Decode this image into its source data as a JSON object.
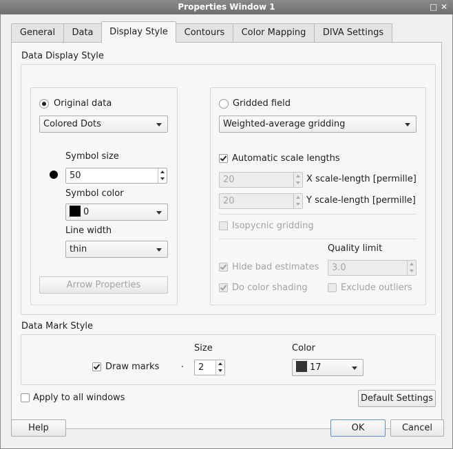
{
  "window": {
    "title": "Properties Window 1",
    "max_icon": "□",
    "close_icon": "✕"
  },
  "tabs": [
    {
      "label": "General",
      "active": false
    },
    {
      "label": "Data",
      "active": false
    },
    {
      "label": "Display Style",
      "active": true
    },
    {
      "label": "Contours",
      "active": false
    },
    {
      "label": "Color Mapping",
      "active": false
    },
    {
      "label": "DIVA Settings",
      "active": false
    }
  ],
  "data_display": {
    "title": "Data Display Style",
    "original_label": "Original data",
    "original_selected": true,
    "style_value": "Colored Dots",
    "symbol_size_label": "Symbol size",
    "symbol_size": "50",
    "symbol_color_label": "Symbol color",
    "symbol_color_value": "0",
    "symbol_color_hex": "#000000",
    "line_width_label": "Line width",
    "line_width_value": "thin",
    "arrow_button": "Arrow Properties",
    "gridded_label": "Gridded field",
    "gridded_selected": false,
    "gridding_value": "Weighted-average gridding",
    "auto_scale_label": "Automatic scale lengths",
    "auto_scale_checked": true,
    "x_scale_value": "20",
    "x_scale_label": "X scale-length [permille]",
    "y_scale_value": "20",
    "y_scale_label": "Y scale-length [permille]",
    "isopycnic_label": "Isopycnic gridding",
    "quality_label": "Quality limit",
    "quality_value": "3.0",
    "hide_bad_label": "Hide bad estimates",
    "color_shading_label": "Do color shading",
    "exclude_outliers_label": "Exclude outliers"
  },
  "data_mark": {
    "title": "Data Mark Style",
    "draw_marks_label": "Draw marks",
    "draw_marks_checked": true,
    "size_label": "Size",
    "size_value": "2",
    "color_label": "Color",
    "color_value": "17",
    "color_hex": "#333333"
  },
  "apply_all_label": "Apply to all windows",
  "default_button": "Default Settings",
  "footer": {
    "help": "Help",
    "ok": "OK",
    "cancel": "Cancel"
  }
}
